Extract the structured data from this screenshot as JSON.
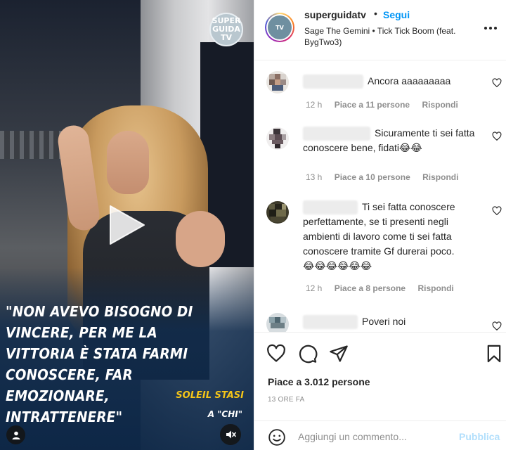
{
  "media": {
    "logo_text": "SUPER GUIDA TV",
    "quote": "\"NON AVEVO BISOGNO DI VINCERE, PER ME LA VITTORIA È STATA FARMI CONOSCERE, FAR EMOZIONARE, INTRATTENERE\"",
    "attribution": "SOLEIL STASI",
    "source": "A \"CHI\""
  },
  "header": {
    "username": "superguidatv",
    "dot": "•",
    "follow_label": "Segui",
    "song": "Sage The Gemini • Tick Tick Boom (feat. BygTwo3)"
  },
  "comments": [
    {
      "text": "Ancora aaaaaaaaa",
      "time": "12 h",
      "likes": "Piace a 11 persone",
      "reply": "Rispondi"
    },
    {
      "text": "Sicuramente ti sei fatta conoscere bene, fidati",
      "emojis": "😂😂",
      "time": "13 h",
      "likes": "Piace a 10 persone",
      "reply": "Rispondi"
    },
    {
      "text": "Ti sei fatta conoscere perfettamente, se ti presenti negli ambienti di lavoro come ti sei fatta conoscere tramite Gf durerai poco.",
      "emojis": "😂😂😂😂😂😂",
      "time": "12 h",
      "likes": "Piace a 8 persone",
      "reply": "Rispondi"
    },
    {
      "text": "Poveri noi"
    }
  ],
  "actions": {
    "likes": "Piace a 3.012 persone",
    "time": "13 ORE FA"
  },
  "add_comment": {
    "placeholder": "Aggiungi un commento...",
    "publish_label": "Pubblica"
  },
  "icons": {
    "like": "heart-icon",
    "comment": "comment-icon",
    "share": "paper-plane-icon",
    "save": "bookmark-icon",
    "emoji": "smiley-icon",
    "more": "more-horizontal-icon",
    "play": "play-icon",
    "mute": "speaker-muted-icon",
    "tag": "person-tag-icon"
  },
  "colors": {
    "follow": "#0095f6",
    "publish_disabled": "#b2dffc",
    "attribution": "#f5c518",
    "meta": "#8e8e8e"
  }
}
